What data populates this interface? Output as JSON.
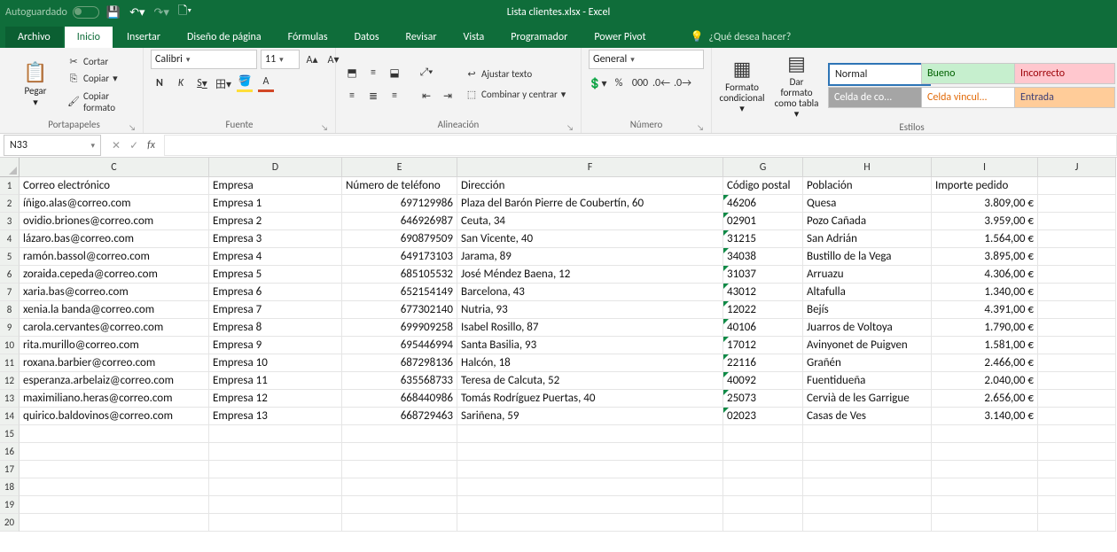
{
  "titlebar": {
    "autosave": "Autoguardado",
    "title": "Lista clientes.xlsx  -  Excel"
  },
  "tabs": {
    "archivo": "Archivo",
    "inicio": "Inicio",
    "insertar": "Insertar",
    "diseno": "Diseño de página",
    "formulas": "Fórmulas",
    "datos": "Datos",
    "revisar": "Revisar",
    "vista": "Vista",
    "programador": "Programador",
    "powerpivot": "Power Pivot",
    "tell": "¿Qué desea hacer?"
  },
  "ribbon": {
    "clipboard": {
      "paste": "Pegar",
      "cut": "Cortar",
      "copy": "Copiar",
      "format": "Copiar formato",
      "label": "Portapapeles"
    },
    "font": {
      "name": "Calibri",
      "size": "11",
      "label": "Fuente",
      "bold": "N",
      "italic": "K",
      "underline": "S"
    },
    "align": {
      "wrap": "Ajustar texto",
      "merge": "Combinar y centrar",
      "label": "Alineación"
    },
    "number": {
      "format": "General",
      "label": "Número"
    },
    "styles": {
      "cond": "Formato condicional",
      "table": "Dar formato como tabla",
      "label": "Estilos",
      "cells": {
        "normal": "Normal",
        "bueno": "Bueno",
        "incorrecto": "Incorrecto",
        "celda": "Celda de co...",
        "vinc": "Celda vincul...",
        "entrada": "Entrada"
      }
    }
  },
  "formula_bar": {
    "name_box": "N33",
    "formula": ""
  },
  "sheet": {
    "col_letters": [
      "C",
      "D",
      "E",
      "F",
      "G",
      "H",
      "I",
      "J"
    ],
    "row_numbers": [
      "1",
      "2",
      "3",
      "4",
      "5",
      "6",
      "7",
      "8",
      "9",
      "10",
      "11",
      "12",
      "13",
      "14",
      "15",
      "16",
      "17",
      "18",
      "19",
      "20"
    ],
    "headers": {
      "c": "Correo electrónico",
      "d": "Empresa",
      "e": "Número de teléfono",
      "f": "Dirección",
      "g": "Código postal",
      "h": "Población",
      "i": "Importe pedido"
    },
    "rows": [
      {
        "c": "íñigo.alas@correo.com",
        "d": "Empresa 1",
        "e": "697129986",
        "f": "Plaza del Barón Pierre de Coubertín, 60",
        "g": "46206",
        "h": "Quesa",
        "i": "3.809,00 €"
      },
      {
        "c": "ovidio.briones@correo.com",
        "d": "Empresa 2",
        "e": "646926987",
        "f": "Ceuta, 34",
        "g": "02901",
        "h": "Pozo Cañada",
        "i": "3.959,00 €"
      },
      {
        "c": "lázaro.bas@correo.com",
        "d": "Empresa 3",
        "e": "690879509",
        "f": "San Vicente, 40",
        "g": "31215",
        "h": "San Adrián",
        "i": "1.564,00 €"
      },
      {
        "c": "ramón.bassol@correo.com",
        "d": "Empresa 4",
        "e": "649173103",
        "f": "Jarama, 89",
        "g": "34038",
        "h": "Bustillo de la Vega",
        "i": "3.895,00 €"
      },
      {
        "c": "zoraida.cepeda@correo.com",
        "d": "Empresa 5",
        "e": "685105532",
        "f": "José Méndez Baena, 12",
        "g": "31037",
        "h": "Arruazu",
        "i": "4.306,00 €"
      },
      {
        "c": "xaria.bas@correo.com",
        "d": "Empresa 6",
        "e": "652154149",
        "f": "Barcelona, 43",
        "g": "43012",
        "h": "Altafulla",
        "i": "1.340,00 €"
      },
      {
        "c": "xenia.la banda@correo.com",
        "d": "Empresa 7",
        "e": "677302140",
        "f": "Nutria, 93",
        "g": "12022",
        "h": "Bejís",
        "i": "4.391,00 €"
      },
      {
        "c": "carola.cervantes@correo.com",
        "d": "Empresa 8",
        "e": "699909258",
        "f": "Isabel Rosillo, 87",
        "g": "40106",
        "h": "Juarros de Voltoya",
        "i": "1.790,00 €"
      },
      {
        "c": "rita.murillo@correo.com",
        "d": "Empresa 9",
        "e": "695446994",
        "f": "Santa Basilia, 93",
        "g": "17012",
        "h": "Avinyonet de Puigven",
        "i": "1.581,00 €"
      },
      {
        "c": "roxana.barbier@correo.com",
        "d": "Empresa 10",
        "e": "687298136",
        "f": "Halcón, 18",
        "g": "22116",
        "h": "Grañén",
        "i": "2.466,00 €"
      },
      {
        "c": "esperanza.arbelaiz@correo.com",
        "d": "Empresa 11",
        "e": "635568733",
        "f": "Teresa de Calcuta, 52",
        "g": "40092",
        "h": "Fuentidueña",
        "i": "2.040,00 €"
      },
      {
        "c": "maximiliano.heras@correo.com",
        "d": "Empresa 12",
        "e": "668440986",
        "f": "Tomás Rodríguez Puertas, 40",
        "g": "25073",
        "h": "Cervià de les Garrigue",
        "i": "2.656,00 €"
      },
      {
        "c": "quirico.baldovinos@correo.com",
        "d": "Empresa 13",
        "e": "668729463",
        "f": "Sariñena, 59",
        "g": "02023",
        "h": "Casas de Ves",
        "i": "3.140,00 €"
      }
    ]
  }
}
